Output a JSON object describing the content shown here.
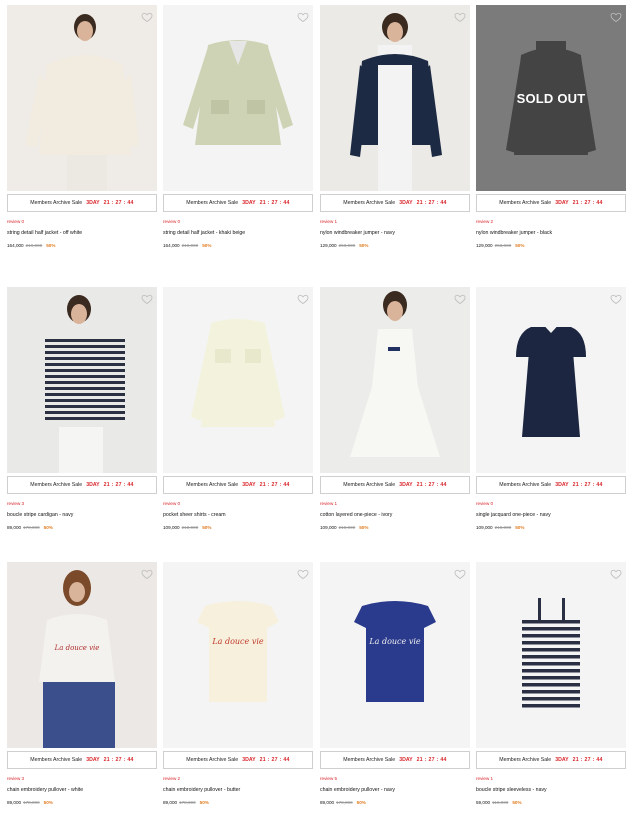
{
  "sale_bar": {
    "prefix": "Members Archive Sale",
    "day": "3DAY",
    "time": "21 : 27 : 44"
  },
  "sold_out_label": "SOLD OUT",
  "products": [
    {
      "review": "review 0",
      "name": "string detail half jacket - off white",
      "price": "164,000",
      "original_price": "219,000",
      "discount": "50%",
      "sold_out": false,
      "image": "model in off-white jacket",
      "colors": {
        "bg": "#efebe6",
        "garment": "#f1ebe0"
      }
    },
    {
      "review": "review 0",
      "name": "string detail half jacket - khaki beige",
      "price": "164,000",
      "original_price": "219,000",
      "discount": "50%",
      "sold_out": false,
      "image": "khaki beige jacket flat",
      "colors": {
        "bg": "#f4f4f4",
        "garment": "#cfd3b5"
      }
    },
    {
      "review": "review 1",
      "name": "nylon windbreaker jumper - navy",
      "price": "129,000",
      "original_price": "258,000",
      "discount": "50%",
      "sold_out": false,
      "image": "model in navy windbreaker",
      "colors": {
        "bg": "#eceae6",
        "garment": "#1d2a44"
      }
    },
    {
      "review": "review 2",
      "name": "nylon windbreaker jumper - black",
      "price": "129,000",
      "original_price": "258,000",
      "discount": "50%",
      "sold_out": true,
      "image": "black windbreaker flat",
      "colors": {
        "bg": "#8c8c8c",
        "garment": "#121212"
      }
    },
    {
      "review": "review 3",
      "name": "boucle stripe cardigan - navy",
      "price": "89,000",
      "original_price": "178,000",
      "discount": "50%",
      "sold_out": false,
      "image": "model in striped cardigan",
      "colors": {
        "bg": "#e9e9e7",
        "garment": "#2b3042"
      }
    },
    {
      "review": "review 0",
      "name": "pocket sheer shirts - cream",
      "price": "109,000",
      "original_price": "218,000",
      "discount": "50%",
      "sold_out": false,
      "image": "cream sheer shirt flat",
      "colors": {
        "bg": "#f4f4f4",
        "garment": "#f3f3dd"
      }
    },
    {
      "review": "review 1",
      "name": "cotton layered one-piece - ivory",
      "price": "109,000",
      "original_price": "218,000",
      "discount": "50%",
      "sold_out": false,
      "image": "model in ivory dress",
      "colors": {
        "bg": "#ececea",
        "garment": "#f7f7f4"
      }
    },
    {
      "review": "review 0",
      "name": "single jacquard one-piece - navy",
      "price": "109,000",
      "original_price": "218,000",
      "discount": "50%",
      "sold_out": false,
      "image": "navy collared dress flat",
      "colors": {
        "bg": "#f4f4f4",
        "garment": "#1c2640"
      }
    },
    {
      "review": "review 3",
      "name": "chain embroidery pullover - white",
      "price": "89,000",
      "original_price": "178,000",
      "discount": "50%",
      "sold_out": false,
      "image": "model in white knit",
      "colors": {
        "bg": "#ebe8e5",
        "garment": "#f4f2ee"
      }
    },
    {
      "review": "review 2",
      "name": "chain embroidery pullover - butter",
      "price": "89,000",
      "original_price": "178,000",
      "discount": "50%",
      "sold_out": false,
      "image": "butter knit flat",
      "colors": {
        "bg": "#f4f4f4",
        "garment": "#f6f0dc"
      }
    },
    {
      "review": "review 5",
      "name": "chain embroidery pullover - navy",
      "price": "89,000",
      "original_price": "178,000",
      "discount": "50%",
      "sold_out": false,
      "image": "navy knit flat",
      "colors": {
        "bg": "#f4f4f4",
        "garment": "#2a3a8c"
      }
    },
    {
      "review": "review 1",
      "name": "boucle stripe sleeveless - navy",
      "price": "59,000",
      "original_price": "118,000",
      "discount": "50%",
      "sold_out": false,
      "image": "striped sleeveless flat",
      "colors": {
        "bg": "#f4f4f4",
        "garment": "#2a2f44"
      }
    }
  ]
}
